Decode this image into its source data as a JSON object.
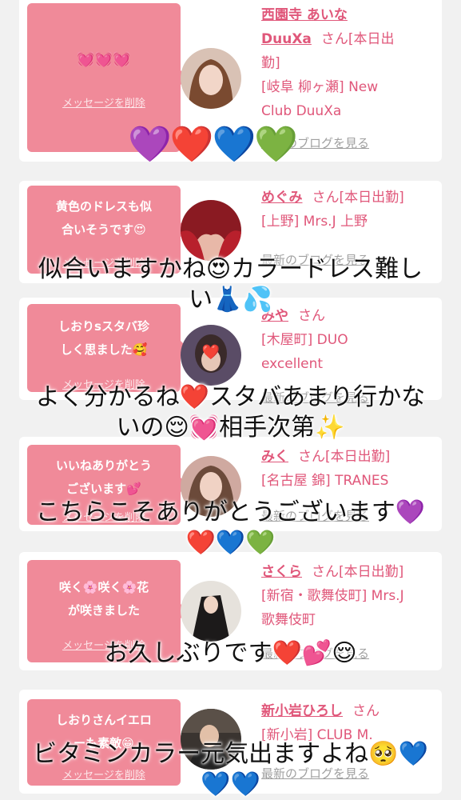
{
  "colors": {
    "bubble": "#f08a99",
    "name_pink": "#e0577a",
    "link_gray": "#a0a0a0",
    "background": "#f1f1f1"
  },
  "cards": [
    {
      "bubble_text": "💓💓💓",
      "delete_label": "メッセージを削除",
      "name": "西園寺 あいな DuuXa",
      "name_line1": "西園寺 あいな",
      "name_line2": "DuuXa",
      "suffix": "さん[本日出",
      "suffix2": "勤]",
      "shop_line1": "[岐阜 柳ヶ瀬] New",
      "shop_line2": "Club DuuXa",
      "blog_link": "最新のブログを見る",
      "avatar_icon": "avatar-photo"
    },
    {
      "bubble_text_line1": "黄色のドレスも似",
      "bubble_text_line2": "合いそうです😍",
      "delete_label": "メッセージを削除",
      "name": "めぐみ",
      "suffix": "さん[本日出勤]",
      "shop_line1": "[上野] Mrs.J 上野",
      "blog_link": "最新のブログを見る",
      "avatar_icon": "avatar-photo"
    },
    {
      "bubble_text_line1": "しおりsスタバ珍",
      "bubble_text_line2": "しく思ました🥰",
      "delete_label": "メッセージを削除",
      "name": "みや",
      "suffix": "さん",
      "shop_line1": "[木屋町] DUO",
      "shop_line2": "excellent",
      "blog_link": "最新のブログを見る",
      "avatar_icon": "avatar-photo"
    },
    {
      "bubble_text_line1": "いいねありがとう",
      "bubble_text_line2": "ございます💕",
      "delete_label": "メッセージを削除",
      "name": "みく",
      "suffix": "さん[本日出勤]",
      "shop_line1": "[名古屋 錦] TRANES",
      "blog_link": "最新のブログを見る",
      "avatar_icon": "avatar-photo"
    },
    {
      "bubble_text_line1": "咲く🌸咲く🌸花",
      "bubble_text_line2": "が咲きました",
      "delete_label": "メッセージを削除",
      "name": "さくら",
      "suffix": "さん[本日出勤]",
      "shop_line1": "[新宿・歌舞伎町] Mrs.J",
      "shop_line2": "歌舞伎町",
      "blog_link": "最新のブログを見る",
      "avatar_icon": "avatar-photo"
    },
    {
      "bubble_text_line1": "しおりさんイエロ",
      "bubble_text_line2": "ーも素敵😁",
      "delete_label": "メッセージを削除",
      "name": "新小岩ひろし",
      "suffix": "さん",
      "shop_line1": "[新小岩] CLUB M.",
      "blog_link": "最新のブログを見る",
      "avatar_icon": "avatar-photo"
    }
  ],
  "overlays": {
    "hearts_1": "💜❤️💙💚",
    "caption_1_line1": "似合いますかね😍カラードレス難し",
    "caption_1_line2": "い👗💦",
    "caption_2_line1": "よく分かるね❤️スタバあまり行かな",
    "caption_2_line2": "いの😌💓相手次第✨",
    "caption_3_line1": "こちらこそありがとうございます💜",
    "caption_3_line2": "❤️💙💚",
    "caption_4": "お久しぶりです❤️💕😌",
    "caption_5_line1": "ビタミンカラー元気出ますよね🥺💙",
    "caption_5_line2": "💙💙"
  }
}
